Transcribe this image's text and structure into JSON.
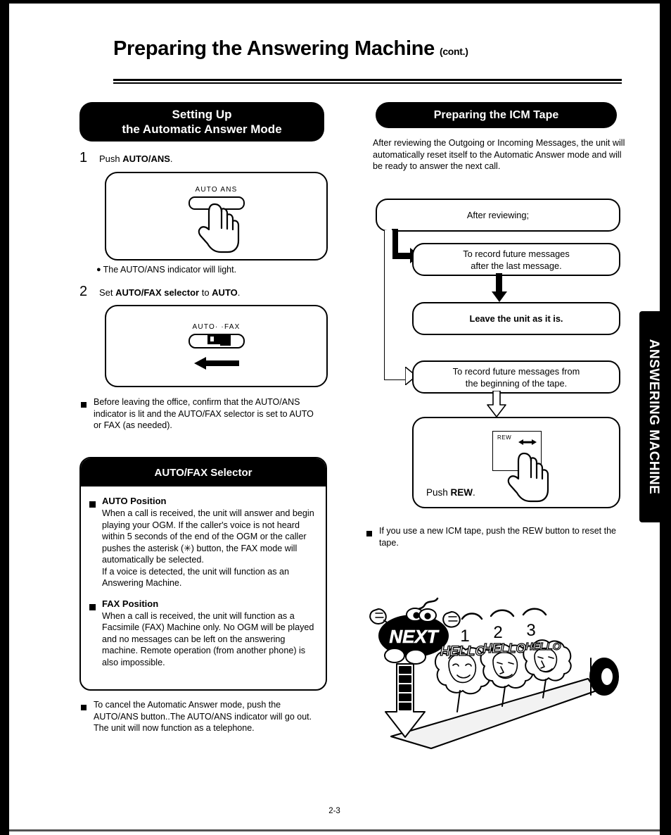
{
  "page": {
    "title": "Preparing the Answering Machine",
    "title_suffix": "(cont.)",
    "page_number": "2-3",
    "side_tab": "ANSWERING MACHINE",
    "accent_color": "#000000",
    "background_color": "#ffffff"
  },
  "left_column": {
    "banner_line1": "Setting Up",
    "banner_line2": "the Automatic Answer Mode",
    "steps": [
      {
        "number": "1",
        "text_plain": "Push AUTO/ANS.",
        "text_pre": "Push ",
        "text_bold": "AUTO/ANS",
        "text_post": ".",
        "figure": {
          "button_label": "AUTO ANS",
          "icon": "pointing-hand-icon"
        },
        "note": "The AUTO/ANS indicator will light."
      },
      {
        "number": "2",
        "text_plain": "Set AUTO/FAX selector to AUTO.",
        "text_pre": "Set ",
        "text_bold": "AUTO/FAX selector",
        "text_mid": " to ",
        "text_bold2": "AUTO",
        "text_post": ".",
        "figure": {
          "switch_label": "AUTO· ·FAX",
          "icon": "slide-switch-icon",
          "arrow": "left-arrow-icon"
        }
      }
    ],
    "note_before_leaving": "Before leaving the office, confirm that the AUTO/ANS indicator is lit and the AUTO/FAX selector is set to AUTO or FAX (as needed).",
    "selector_card": {
      "heading": "AUTO/FAX Selector",
      "sections": [
        {
          "title": "AUTO Position",
          "body": "When a call is received, the unit will answer and begin playing your OGM. If the caller's voice is not heard within 5 seconds of the end of the OGM or the caller pushes the asterisk (✳) button, the FAX mode will automatically be selected.",
          "body2": "If a voice is detected, the unit will function as an Answering Machine."
        },
        {
          "title": "FAX Position",
          "body": "When a call is received, the unit will function as a Facsimile (FAX) Machine only. No OGM will be played and no messages can be left on the answering machine. Remote operation (from another phone) is also impossible."
        }
      ]
    },
    "note_cancel": "To cancel the Automatic Answer mode, push the AUTO/ANS button..The AUTO/ANS indicator will go out. The unit will now function as a telephone."
  },
  "right_column": {
    "banner": "Preparing the ICM Tape",
    "intro": "After reviewing the Outgoing or Incoming Messages, the unit will automatically reset itself to the Automatic Answer mode and will be ready to answer the next call.",
    "flow": {
      "start": "After reviewing;",
      "branch_a": "To record future messages after the last message.",
      "branch_a_line1": "To record future messages",
      "branch_a_line2": "after the last message.",
      "result_a": "Leave the unit as it is.",
      "branch_b_line1": "To record future messages from",
      "branch_b_line2": "the beginning of the tape.",
      "result_b_caption_pre": "Push ",
      "result_b_caption_bold": "REW",
      "result_b_caption_post": ".",
      "result_b_button_label": "REW",
      "result_b_button_icon": "rewind-arrow-icon"
    },
    "note_new_tape": "If you use a new ICM tape, push the REW button to reset the tape.",
    "illustration": {
      "character_label": "NEXT",
      "message_numbers": [
        "1",
        "2",
        "3"
      ],
      "message_labels": [
        "HELLO",
        "HELLO",
        "HELLO"
      ],
      "description": "tape-reel-and-messages-illustration"
    }
  }
}
